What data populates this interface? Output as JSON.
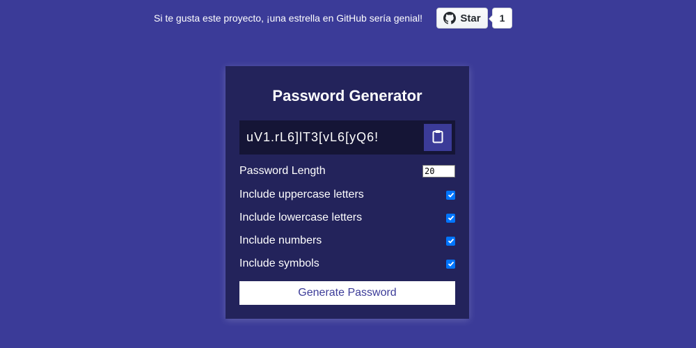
{
  "banner": {
    "text": "Si te gusta este proyecto, ¡una estrella en GitHub sería genial!",
    "star_label": "Star",
    "star_count": "1"
  },
  "app": {
    "title": "Password Generator",
    "password": "uV1.rL6]lT3[vL6[yQ6!",
    "length_label": "Password Length",
    "length_value": "20",
    "options": [
      {
        "label": "Include uppercase letters",
        "checked": true
      },
      {
        "label": "Include lowercase letters",
        "checked": true
      },
      {
        "label": "Include numbers",
        "checked": true
      },
      {
        "label": "Include symbols",
        "checked": true
      }
    ],
    "generate_label": "Generate Password"
  },
  "colors": {
    "background": "#3b3b98",
    "card": "#23235b",
    "checkbox": "#0075ff"
  },
  "icons": {
    "github": "github-icon",
    "clipboard": "clipboard-icon",
    "checkmark": "checkmark-icon"
  }
}
